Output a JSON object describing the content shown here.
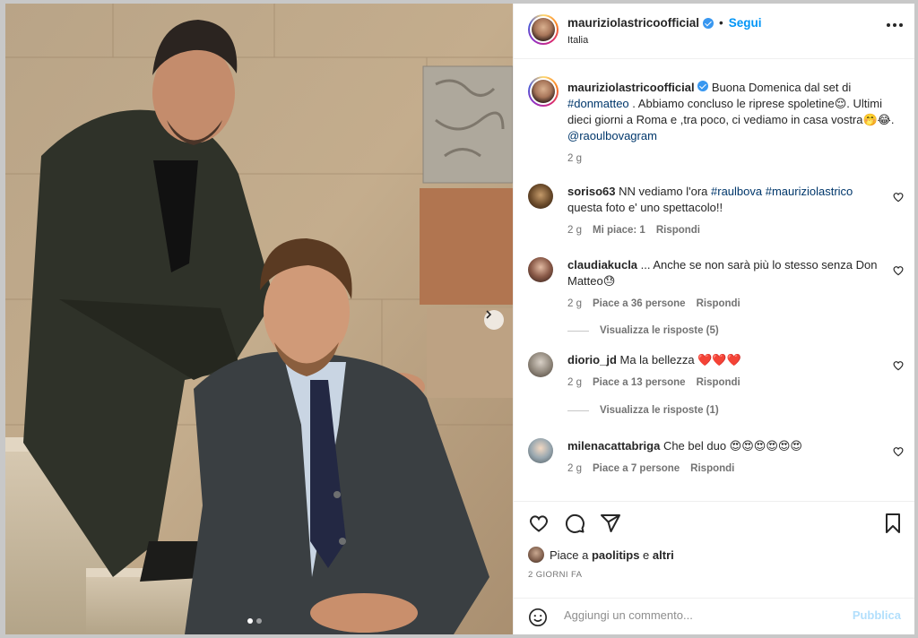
{
  "post": {
    "username": "mauriziolastricoofficial",
    "follow_label": "Segui",
    "location": "Italia",
    "more_label": "Altre opzioni"
  },
  "caption": {
    "username": "mauriziolastricoofficial",
    "text_1": " Buona Domenica dal set di ",
    "hashtag_1": "#donmatteo",
    "text_2": " . Abbiamo concluso le riprese spoletine😌. Ultimi dieci giorni a Roma e ,tra poco, ci vediamo in casa vostra🤭😂.",
    "mention": "@raoulbovagram",
    "time": "2 g"
  },
  "comments": [
    {
      "username": "soriso63",
      "text_1": " NN vediamo l'ora ",
      "tag_1": "#raulbova",
      "tag_2": "#mauriziolastrico",
      "text_2": "questa foto e' uno spettacolo!!",
      "time": "2 g",
      "likes": "Mi piace: 1",
      "reply": "Rispondi"
    },
    {
      "username": "claudiakucla",
      "text": " ... Anche se non sarà più lo stesso senza Don Matteo😓",
      "time": "2 g",
      "likes": "Piace a 36 persone",
      "reply": "Rispondi",
      "view_replies": "Visualizza le risposte (5)"
    },
    {
      "username": "diorio_jd",
      "text": " Ma la bellezza ❤️❤️❤️",
      "time": "2 g",
      "likes": "Piace a 13 persone",
      "reply": "Rispondi",
      "view_replies": "Visualizza le risposte (1)"
    },
    {
      "username": "milenacattabriga",
      "text": " Che bel duo 😍😍😍😍😍😍",
      "time": "2 g",
      "likes": "Piace a 7 persone",
      "reply": "Rispondi"
    }
  ],
  "likes": {
    "prefix": "Piace a ",
    "user": "paolitips",
    "middle": " e ",
    "others": "altri"
  },
  "date": "2 GIORNI FA",
  "add_comment": {
    "placeholder": "Aggiungi un commento...",
    "publish_label": "Pubblica"
  },
  "icons": {
    "like": "heart-icon",
    "comment": "comment-icon",
    "share": "send-icon",
    "save": "bookmark-icon",
    "emoji": "emoji-icon",
    "next": "chevron-right-icon",
    "more": "more-dots-icon"
  },
  "colors": {
    "link_blue": "#0095f6",
    "hashtag": "#00376b",
    "verified": "#3897f0",
    "muted": "#737373"
  }
}
